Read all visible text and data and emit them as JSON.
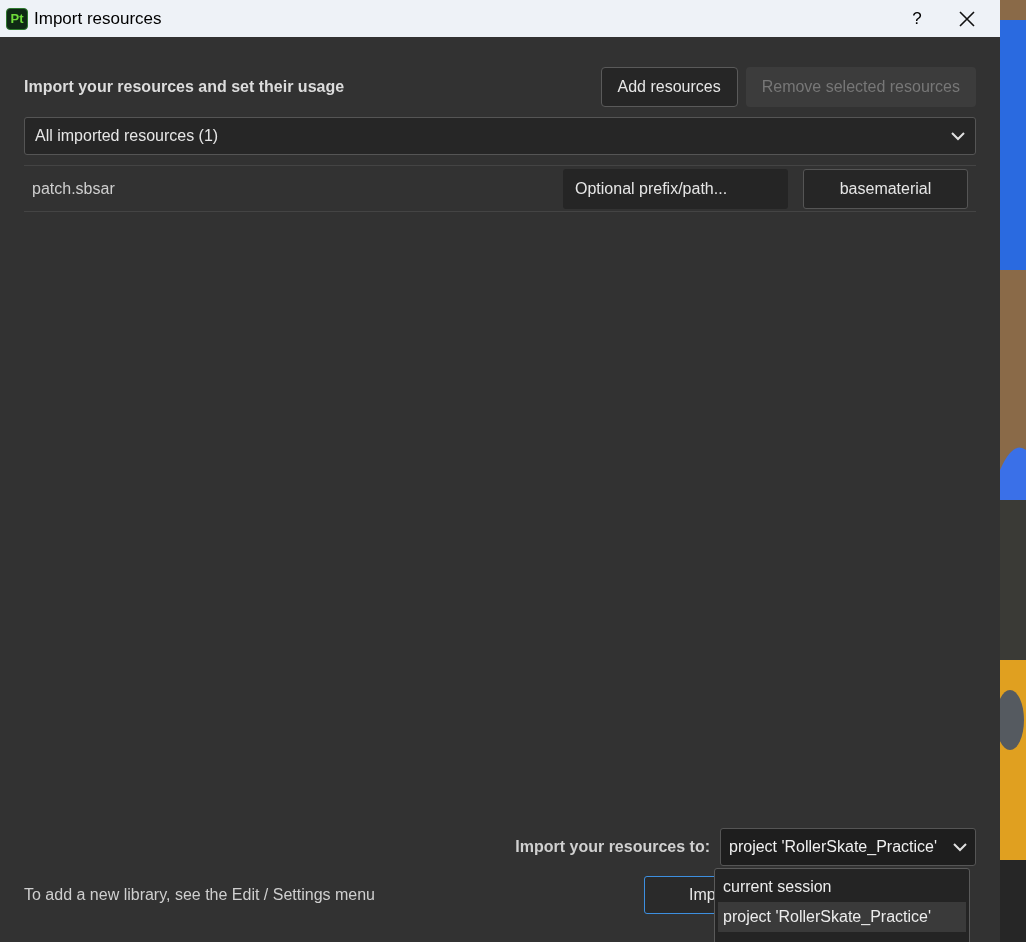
{
  "window": {
    "logo": "Pt",
    "title": "Import resources",
    "help": "?"
  },
  "header": {
    "title": "Import your resources and set their usage",
    "buttons": [
      {
        "label": "Add resources",
        "disabled": false
      },
      {
        "label": "Remove selected resources",
        "disabled": true
      }
    ]
  },
  "filter": {
    "value": "All imported resources (1)"
  },
  "resources": [
    {
      "name": "patch.sbsar",
      "prefix_placeholder": "Optional prefix/path...",
      "usage": "basematerial"
    }
  ],
  "destination": {
    "label": "Import your resources to:",
    "value": "project 'RollerSkate_Practice'",
    "options": [
      {
        "label": "current session",
        "selected": false
      },
      {
        "label": "project 'RollerSkate_Practice'",
        "selected": true
      }
    ]
  },
  "footer": {
    "note": "To add a new library, see the Edit / Settings menu",
    "import_button": "Imp"
  }
}
